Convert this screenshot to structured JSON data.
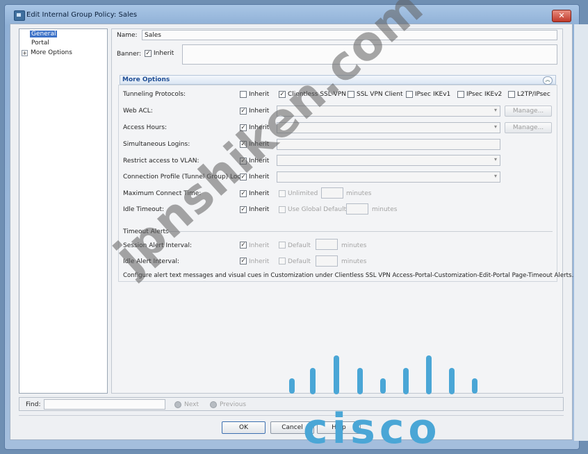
{
  "window": {
    "title": "Edit Internal Group Policy: Sales",
    "close_label": "✕"
  },
  "tree": {
    "items": [
      {
        "label": "General"
      },
      {
        "label": "Portal"
      },
      {
        "label": "More Options"
      }
    ],
    "expand_glyph": "+"
  },
  "general": {
    "name_label": "Name:",
    "name_value": "Sales",
    "banner_label": "Banner:",
    "banner_inherit_label": "Inherit",
    "banner_inherit_checked": true
  },
  "more_options": {
    "title": "More Options",
    "collapse_glyph": "︽",
    "tunneling": {
      "label": "Tunneling Protocols:",
      "options": [
        {
          "label": "Inherit",
          "checked": false
        },
        {
          "label": "Clientless SSL VPN",
          "checked": true
        },
        {
          "label": "SSL VPN Client",
          "checked": false
        },
        {
          "label": "IPsec IKEv1",
          "checked": false
        },
        {
          "label": "IPsec IKEv2",
          "checked": false
        },
        {
          "label": "L2TP/IPsec",
          "checked": false
        }
      ]
    },
    "rows": [
      {
        "label": "Web ACL:",
        "inherit": "Inherit"
      },
      {
        "label": "Access Hours:",
        "inherit": "Inherit"
      },
      {
        "label": "Simultaneous Logins:",
        "inherit": "Inherit"
      },
      {
        "label": "Restrict access to VLAN:",
        "inherit": "Inherit"
      },
      {
        "label": "Connection Profile (Tunnel Group) Lock:",
        "inherit": "Inherit"
      },
      {
        "label": "Maximum Connect Time:",
        "inherit": "Inherit",
        "extra": "Unlimited",
        "unit": "minutes"
      },
      {
        "label": "Idle Timeout:",
        "inherit": "Inherit",
        "extra": "Use Global Default",
        "unit": "minutes"
      }
    ],
    "manage_label": "Manage...",
    "timeout_alerts": {
      "title": "Timeout Alerts",
      "rows": [
        {
          "label": "Session Alert Interval:",
          "inherit": "Inherit",
          "default": "Default",
          "unit": "minutes"
        },
        {
          "label": "Idle Alert Interval:",
          "inherit": "Inherit",
          "default": "Default",
          "unit": "minutes"
        }
      ]
    },
    "footnote": "Configure alert text messages and visual cues in Customization under Clientless SSL VPN Access-Portal-Customization-Edit-Portal Page-Timeout Alerts."
  },
  "find": {
    "label": "Find:",
    "value": "",
    "next_label": "Next",
    "previous_label": "Previous"
  },
  "buttons": {
    "ok": "OK",
    "cancel": "Cancel",
    "help": "Help"
  },
  "watermark": {
    "text": "jpnshiken.com",
    "logo_text": "cisco"
  },
  "colors": {
    "selection": "#3e73c8",
    "section_title": "#1f4e96",
    "cisco_blue": "#4aa6d6"
  }
}
